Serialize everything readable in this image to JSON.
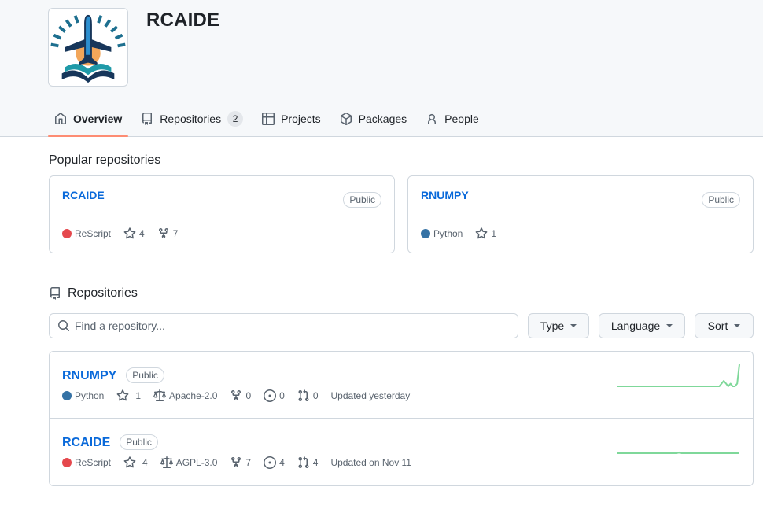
{
  "org": {
    "name": "RCAIDE",
    "avatar_alt": "RCAIDE logo"
  },
  "tabs": [
    {
      "label": "Overview",
      "icon": "home-icon",
      "active": true
    },
    {
      "label": "Repositories",
      "icon": "repo-icon",
      "count": "2"
    },
    {
      "label": "Projects",
      "icon": "table-icon"
    },
    {
      "label": "Packages",
      "icon": "package-icon"
    },
    {
      "label": "People",
      "icon": "person-icon"
    }
  ],
  "popular": {
    "title": "Popular repositories",
    "items": [
      {
        "name": "RCAIDE",
        "visibility": "Public",
        "language": "ReScript",
        "language_color": "#e5484d",
        "stars": "4",
        "forks": "7"
      },
      {
        "name": "RNUMPY",
        "visibility": "Public",
        "language": "Python",
        "language_color": "#3572A5",
        "stars": "1"
      }
    ]
  },
  "repositories": {
    "title": "Repositories",
    "search_placeholder": "Find a repository...",
    "search_value": "",
    "filters": {
      "type": "Type",
      "language": "Language",
      "sort": "Sort"
    },
    "items": [
      {
        "name": "RNUMPY",
        "visibility": "Public",
        "language": "Python",
        "language_color": "#3572A5",
        "stars": "1",
        "license": "Apache-2.0",
        "forks": "0",
        "issues": "0",
        "pulls": "0",
        "updated": "Updated yesterday",
        "activity": [
          0,
          0,
          0,
          0,
          0,
          0,
          0,
          0,
          0,
          0,
          0,
          0,
          0,
          0,
          0,
          0,
          0,
          0,
          0,
          0,
          0,
          0,
          0,
          0,
          0,
          0,
          0,
          0,
          0,
          0,
          0,
          0,
          0,
          0,
          0,
          0,
          0,
          0,
          0,
          0,
          0,
          0,
          0,
          0,
          0,
          0,
          0,
          1,
          2,
          1,
          0,
          1,
          0,
          0,
          1,
          8
        ]
      },
      {
        "name": "RCAIDE",
        "visibility": "Public",
        "language": "ReScript",
        "language_color": "#e5484d",
        "stars": "4",
        "license": "AGPL-3.0",
        "forks": "7",
        "issues": "4",
        "pulls": "4",
        "updated": "Updated on Nov 11",
        "activity": [
          0,
          0,
          0,
          0,
          0,
          0,
          0,
          0,
          0,
          0,
          0,
          0,
          0,
          0,
          0,
          0,
          0,
          0,
          0,
          0,
          0,
          0,
          0,
          0,
          0,
          0,
          0,
          0,
          0.3,
          0,
          0,
          0,
          0,
          0,
          0,
          0,
          0,
          0,
          0,
          0,
          0,
          0,
          0,
          0,
          0,
          0,
          0,
          0,
          0,
          0,
          0,
          0,
          0,
          0,
          0,
          0
        ]
      }
    ]
  },
  "colors": {
    "accent": "#fd8c73",
    "link": "#0969da",
    "spark": "#7fd89a"
  }
}
